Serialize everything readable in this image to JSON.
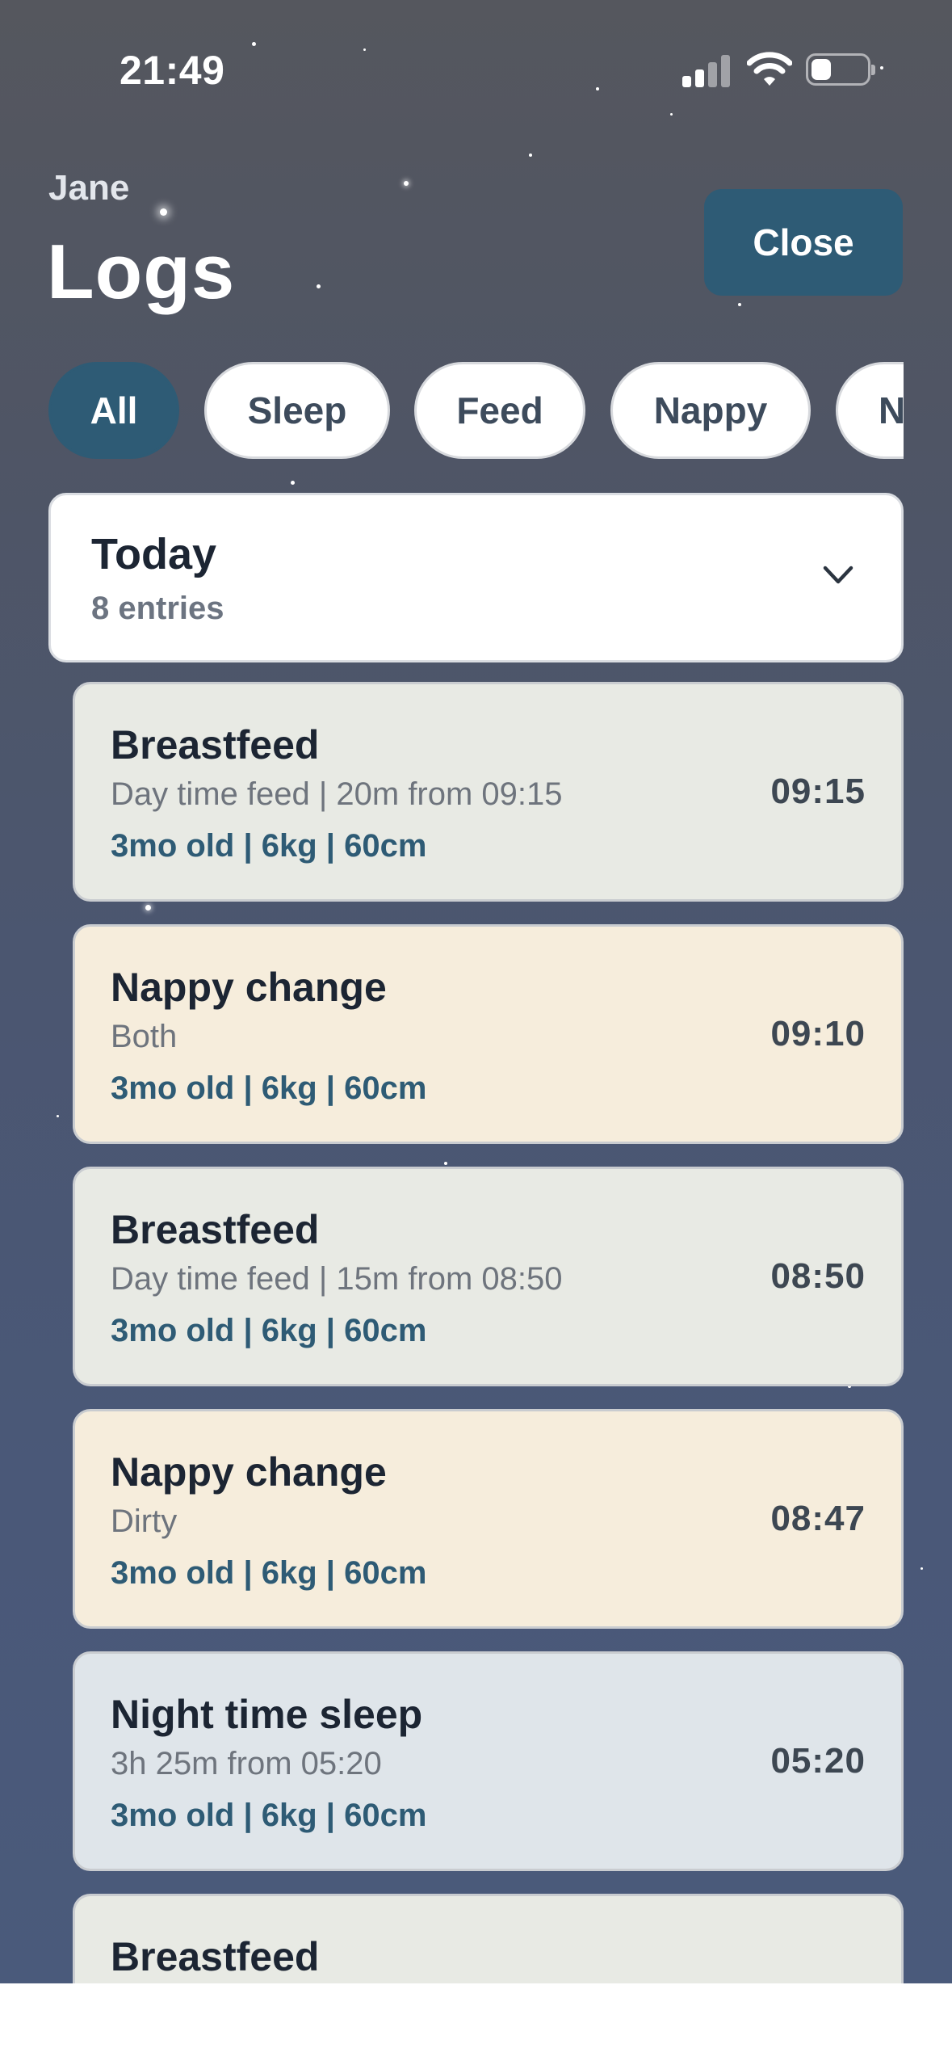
{
  "status_bar": {
    "time": "21:49"
  },
  "header": {
    "subtitle": "Jane",
    "title": "Logs",
    "close_label": "Close"
  },
  "filters": [
    {
      "label": "All",
      "active": true
    },
    {
      "label": "Sleep",
      "active": false
    },
    {
      "label": "Feed",
      "active": false
    },
    {
      "label": "Nappy",
      "active": false
    },
    {
      "label": "N",
      "active": false
    }
  ],
  "day_group": {
    "title": "Today",
    "count": "8 entries"
  },
  "colors": {
    "accent": "#2e5b75",
    "feed_bg": "#e8eae4",
    "nappy_bg": "#f6eddc",
    "sleep_bg": "#dfe5ea"
  },
  "entries": [
    {
      "type": "feed",
      "name": "Breastfeed",
      "detail": "Day time feed | 20m from 09:15",
      "stats": "3mo old | 6kg | 60cm",
      "time": "09:15"
    },
    {
      "type": "nappy",
      "name": "Nappy change",
      "detail": "Both",
      "stats": "3mo old | 6kg | 60cm",
      "time": "09:10"
    },
    {
      "type": "feed",
      "name": "Breastfeed",
      "detail": "Day time feed | 15m from 08:50",
      "stats": "3mo old | 6kg | 60cm",
      "time": "08:50"
    },
    {
      "type": "nappy",
      "name": "Nappy change",
      "detail": "Dirty",
      "stats": "3mo old | 6kg | 60cm",
      "time": "08:47"
    },
    {
      "type": "sleep",
      "name": "Night time sleep",
      "detail": "3h 25m from 05:20",
      "stats": "3mo old | 6kg | 60cm",
      "time": "05:20"
    },
    {
      "type": "feed",
      "name": "Breastfeed",
      "detail": "",
      "stats": "",
      "time": ""
    }
  ]
}
